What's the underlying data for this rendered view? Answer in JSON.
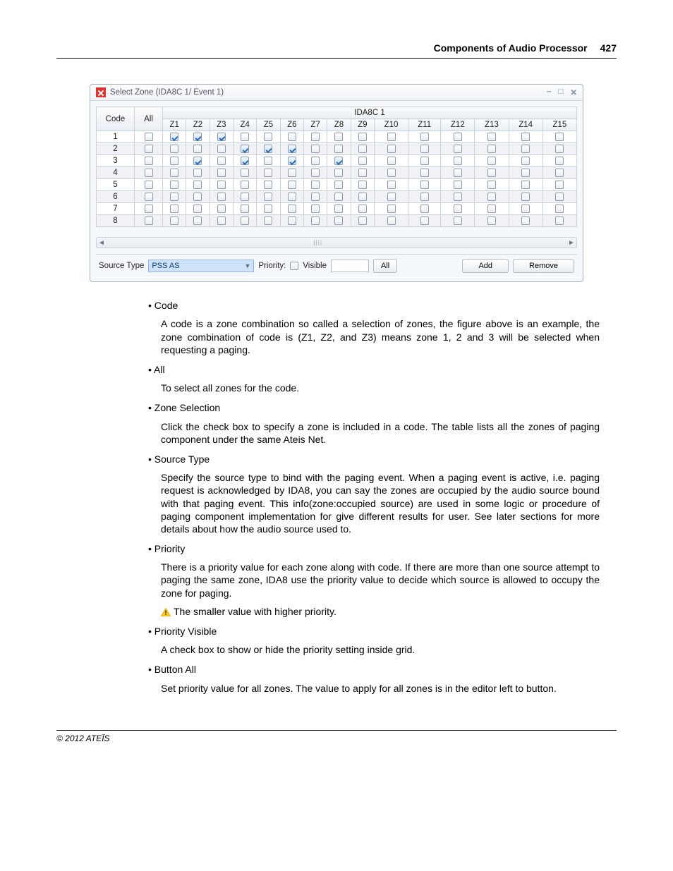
{
  "header": {
    "title": "Components of Audio Processor",
    "page": "427"
  },
  "dialog": {
    "title": "Select Zone (IDA8C 1/ Event 1)",
    "device_group": "IDA8C 1",
    "col_code": "Code",
    "col_all": "All",
    "zone_headers": [
      "Z1",
      "Z2",
      "Z3",
      "Z4",
      "Z5",
      "Z6",
      "Z7",
      "Z8",
      "Z9",
      "Z10",
      "Z11",
      "Z12",
      "Z13",
      "Z14",
      "Z15"
    ],
    "rows": [
      {
        "code": "1",
        "all": false,
        "z": [
          true,
          true,
          true,
          false,
          false,
          false,
          false,
          false,
          false,
          false,
          false,
          false,
          false,
          false,
          false
        ]
      },
      {
        "code": "2",
        "all": false,
        "z": [
          false,
          false,
          false,
          true,
          true,
          true,
          false,
          false,
          false,
          false,
          false,
          false,
          false,
          false,
          false
        ]
      },
      {
        "code": "3",
        "all": false,
        "z": [
          false,
          true,
          false,
          true,
          false,
          true,
          false,
          true,
          false,
          false,
          false,
          false,
          false,
          false,
          false
        ]
      },
      {
        "code": "4",
        "all": false,
        "z": [
          false,
          false,
          false,
          false,
          false,
          false,
          false,
          false,
          false,
          false,
          false,
          false,
          false,
          false,
          false
        ]
      },
      {
        "code": "5",
        "all": false,
        "z": [
          false,
          false,
          false,
          false,
          false,
          false,
          false,
          false,
          false,
          false,
          false,
          false,
          false,
          false,
          false
        ]
      },
      {
        "code": "6",
        "all": false,
        "z": [
          false,
          false,
          false,
          false,
          false,
          false,
          false,
          false,
          false,
          false,
          false,
          false,
          false,
          false,
          false
        ]
      },
      {
        "code": "7",
        "all": false,
        "z": [
          false,
          false,
          false,
          false,
          false,
          false,
          false,
          false,
          false,
          false,
          false,
          false,
          false,
          false,
          false
        ]
      },
      {
        "code": "8",
        "all": false,
        "z": [
          false,
          false,
          false,
          false,
          false,
          false,
          false,
          false,
          false,
          false,
          false,
          false,
          false,
          false,
          false
        ]
      }
    ],
    "footer": {
      "source_type_label": "Source Type",
      "source_type_value": "PSS AS",
      "priority_label": "Priority:",
      "visible_label": "Visible",
      "all_btn": "All",
      "add_btn": "Add",
      "remove_btn": "Remove"
    }
  },
  "doc": {
    "items": [
      {
        "title": "Code",
        "desc": "A code is a zone combination so called a selection of zones, the figure above is an example, the zone combination of code is (Z1, Z2, and Z3) means zone 1, 2 and 3 will be selected when requesting a paging."
      },
      {
        "title": "All",
        "desc": "To select all zones for the code."
      },
      {
        "title": "Zone Selection",
        "desc": "Click the check box to specify a zone is included in a code. The table lists all the zones of paging component under the same Ateis Net."
      },
      {
        "title": "Source Type",
        "desc": "Specify the source type to bind with the paging event. When a paging event is active, i.e. paging request is acknowledged by IDA8, you can say the zones are occupied by the audio source bound with that paging event. This info(zone:occupied source) are used in some logic or procedure of paging component implementation for give different results for user. See later sections for more details about how the audio source used to."
      },
      {
        "title": "Priority",
        "desc": "There is a priority value for each zone along with code. If there are more than one source attempt to paging the same zone, IDA8 use the priority value to decide which source is allowed to occupy the zone for paging.",
        "warn": "The smaller value with higher priority."
      },
      {
        "title": "Priority Visible",
        "desc": "A check box to show or hide the priority setting inside grid."
      },
      {
        "title": "Button All",
        "desc": "Set priority value for all zones. The value to apply for all zones is in the editor left to button."
      }
    ]
  },
  "copyright": "© 2012 ATEÏS"
}
